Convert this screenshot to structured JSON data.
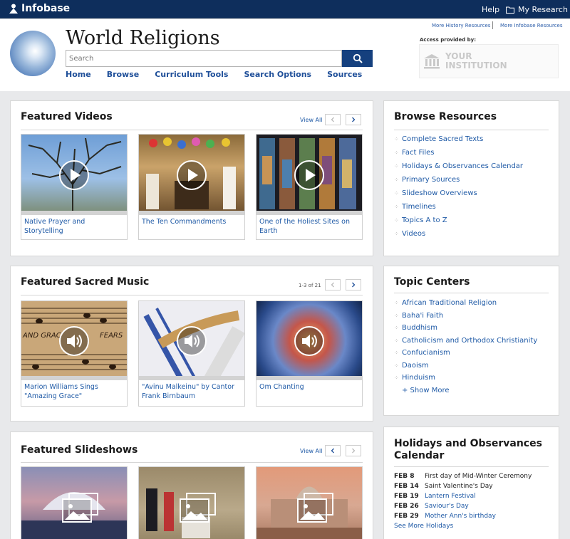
{
  "topbar": {
    "brand": "Infobase",
    "help": "Help",
    "my_research": "My Research"
  },
  "header": {
    "title": "World Religions",
    "search_placeholder": "Search",
    "nav": [
      "Home",
      "Browse",
      "Curriculum Tools",
      "Search Options",
      "Sources"
    ],
    "more_history": "More History Resources",
    "more_infobase": "More Infobase Resources",
    "access_label": "Access provided by:",
    "institution_line1": "YOUR",
    "institution_line2": "INSTITUTION"
  },
  "featured_videos": {
    "title": "Featured Videos",
    "view_all": "View All",
    "items": [
      "Native Prayer and Storytelling",
      "The Ten Commandments",
      "One of the Holiest Sites on Earth"
    ]
  },
  "featured_music": {
    "title": "Featured Sacred Music",
    "pager": "1-3 of 21",
    "items": [
      "Marion Williams Sings \"Amazing Grace\"",
      "\"Avinu Malkeinu\" by Cantor Frank Birnbaum",
      "Om Chanting"
    ],
    "sheet_text_1": "AND GRAC",
    "sheet_text_2": "FEARS"
  },
  "featured_slideshows": {
    "title": "Featured Slideshows",
    "view_all": "View All"
  },
  "browse_resources": {
    "title": "Browse Resources",
    "items": [
      "Complete Sacred Texts",
      "Fact Files",
      "Holidays & Observances Calendar",
      "Primary Sources",
      "Slideshow Overviews",
      "Timelines",
      "Topics A to Z",
      "Videos"
    ]
  },
  "topic_centers": {
    "title": "Topic Centers",
    "items": [
      "African Traditional Religion",
      "Baha'i Faith",
      "Buddhism",
      "Catholicism and Orthodox Christianity",
      "Confucianism",
      "Daoism",
      "Hinduism"
    ],
    "show_more": "+ Show More"
  },
  "holidays": {
    "title_line1": "Holidays and Observances",
    "title_line2": "Calendar",
    "rows": [
      {
        "date": "FEB 8",
        "name": "First day of Mid-Winter Ceremony"
      },
      {
        "date": "FEB 14",
        "name": "Saint Valentine's Day"
      },
      {
        "date": "FEB 19",
        "name": "Lantern Festival"
      },
      {
        "date": "FEB 26",
        "name": "Saviour's Day"
      },
      {
        "date": "FEB 29",
        "name": "Mother Ann's birthday"
      }
    ],
    "see_more": "See More Holidays"
  },
  "colors": {
    "topbar": "#0e2e5c",
    "accent": "#15407e",
    "link": "#1f5aa6"
  }
}
